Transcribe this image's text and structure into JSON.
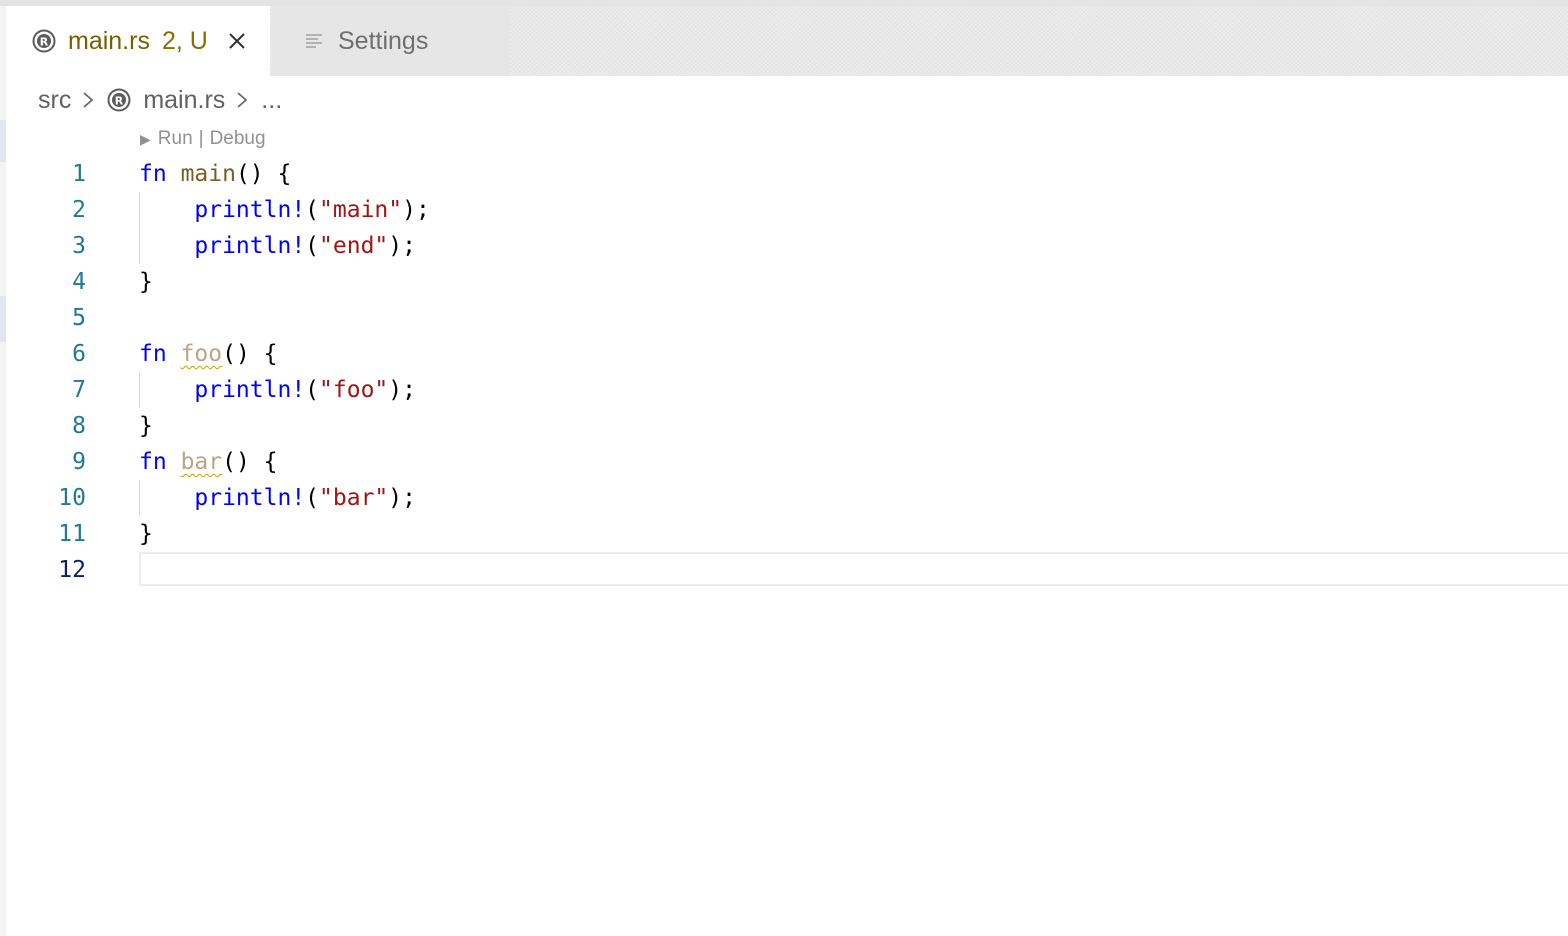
{
  "tabs": [
    {
      "label": "main.rs",
      "status": "2, U",
      "icon": "rust-icon",
      "active": true
    },
    {
      "label": "Settings",
      "icon": "settings-icon",
      "active": false
    }
  ],
  "breadcrumb": {
    "folder": "src",
    "file": "main.rs",
    "more": "..."
  },
  "codelens": {
    "run": "Run",
    "separator": "|",
    "debug": "Debug"
  },
  "lines": [
    {
      "number": "1",
      "tokens": [
        {
          "t": "fn",
          "c": "kw"
        },
        {
          "t": " "
        },
        {
          "t": "main",
          "c": "fn-name"
        },
        {
          "t": "() {"
        }
      ]
    },
    {
      "number": "2",
      "tokens": [
        {
          "t": "    "
        },
        {
          "t": "println!",
          "c": "macro"
        },
        {
          "t": "("
        },
        {
          "t": "\"main\"",
          "c": "str"
        },
        {
          "t": ");"
        }
      ]
    },
    {
      "number": "3",
      "tokens": [
        {
          "t": "    "
        },
        {
          "t": "println!",
          "c": "macro"
        },
        {
          "t": "("
        },
        {
          "t": "\"end\"",
          "c": "str"
        },
        {
          "t": ");"
        }
      ]
    },
    {
      "number": "4",
      "tokens": [
        {
          "t": "}"
        }
      ]
    },
    {
      "number": "5",
      "tokens": []
    },
    {
      "number": "6",
      "tokens": [
        {
          "t": "fn",
          "c": "kw"
        },
        {
          "t": " "
        },
        {
          "t": "foo",
          "c": "fn-name unused"
        },
        {
          "t": "() {"
        }
      ]
    },
    {
      "number": "7",
      "tokens": [
        {
          "t": "    "
        },
        {
          "t": "println!",
          "c": "macro"
        },
        {
          "t": "("
        },
        {
          "t": "\"foo\"",
          "c": "str"
        },
        {
          "t": ");"
        }
      ]
    },
    {
      "number": "8",
      "tokens": [
        {
          "t": "}"
        }
      ]
    },
    {
      "number": "9",
      "tokens": [
        {
          "t": "fn",
          "c": "kw"
        },
        {
          "t": " "
        },
        {
          "t": "bar",
          "c": "fn-name unused"
        },
        {
          "t": "() {"
        }
      ]
    },
    {
      "number": "10",
      "tokens": [
        {
          "t": "    "
        },
        {
          "t": "println!",
          "c": "macro"
        },
        {
          "t": "("
        },
        {
          "t": "\"bar\"",
          "c": "str"
        },
        {
          "t": ");"
        }
      ]
    },
    {
      "number": "11",
      "tokens": [
        {
          "t": "}"
        }
      ]
    },
    {
      "number": "12",
      "tokens": [],
      "current": true
    }
  ],
  "colors": {
    "keyword": "#0000ff",
    "function": "#795e26",
    "string": "#a31515",
    "line_number": "#237893",
    "warning_squiggle": "#c5a000",
    "modified_tab": "#7a5d00"
  }
}
